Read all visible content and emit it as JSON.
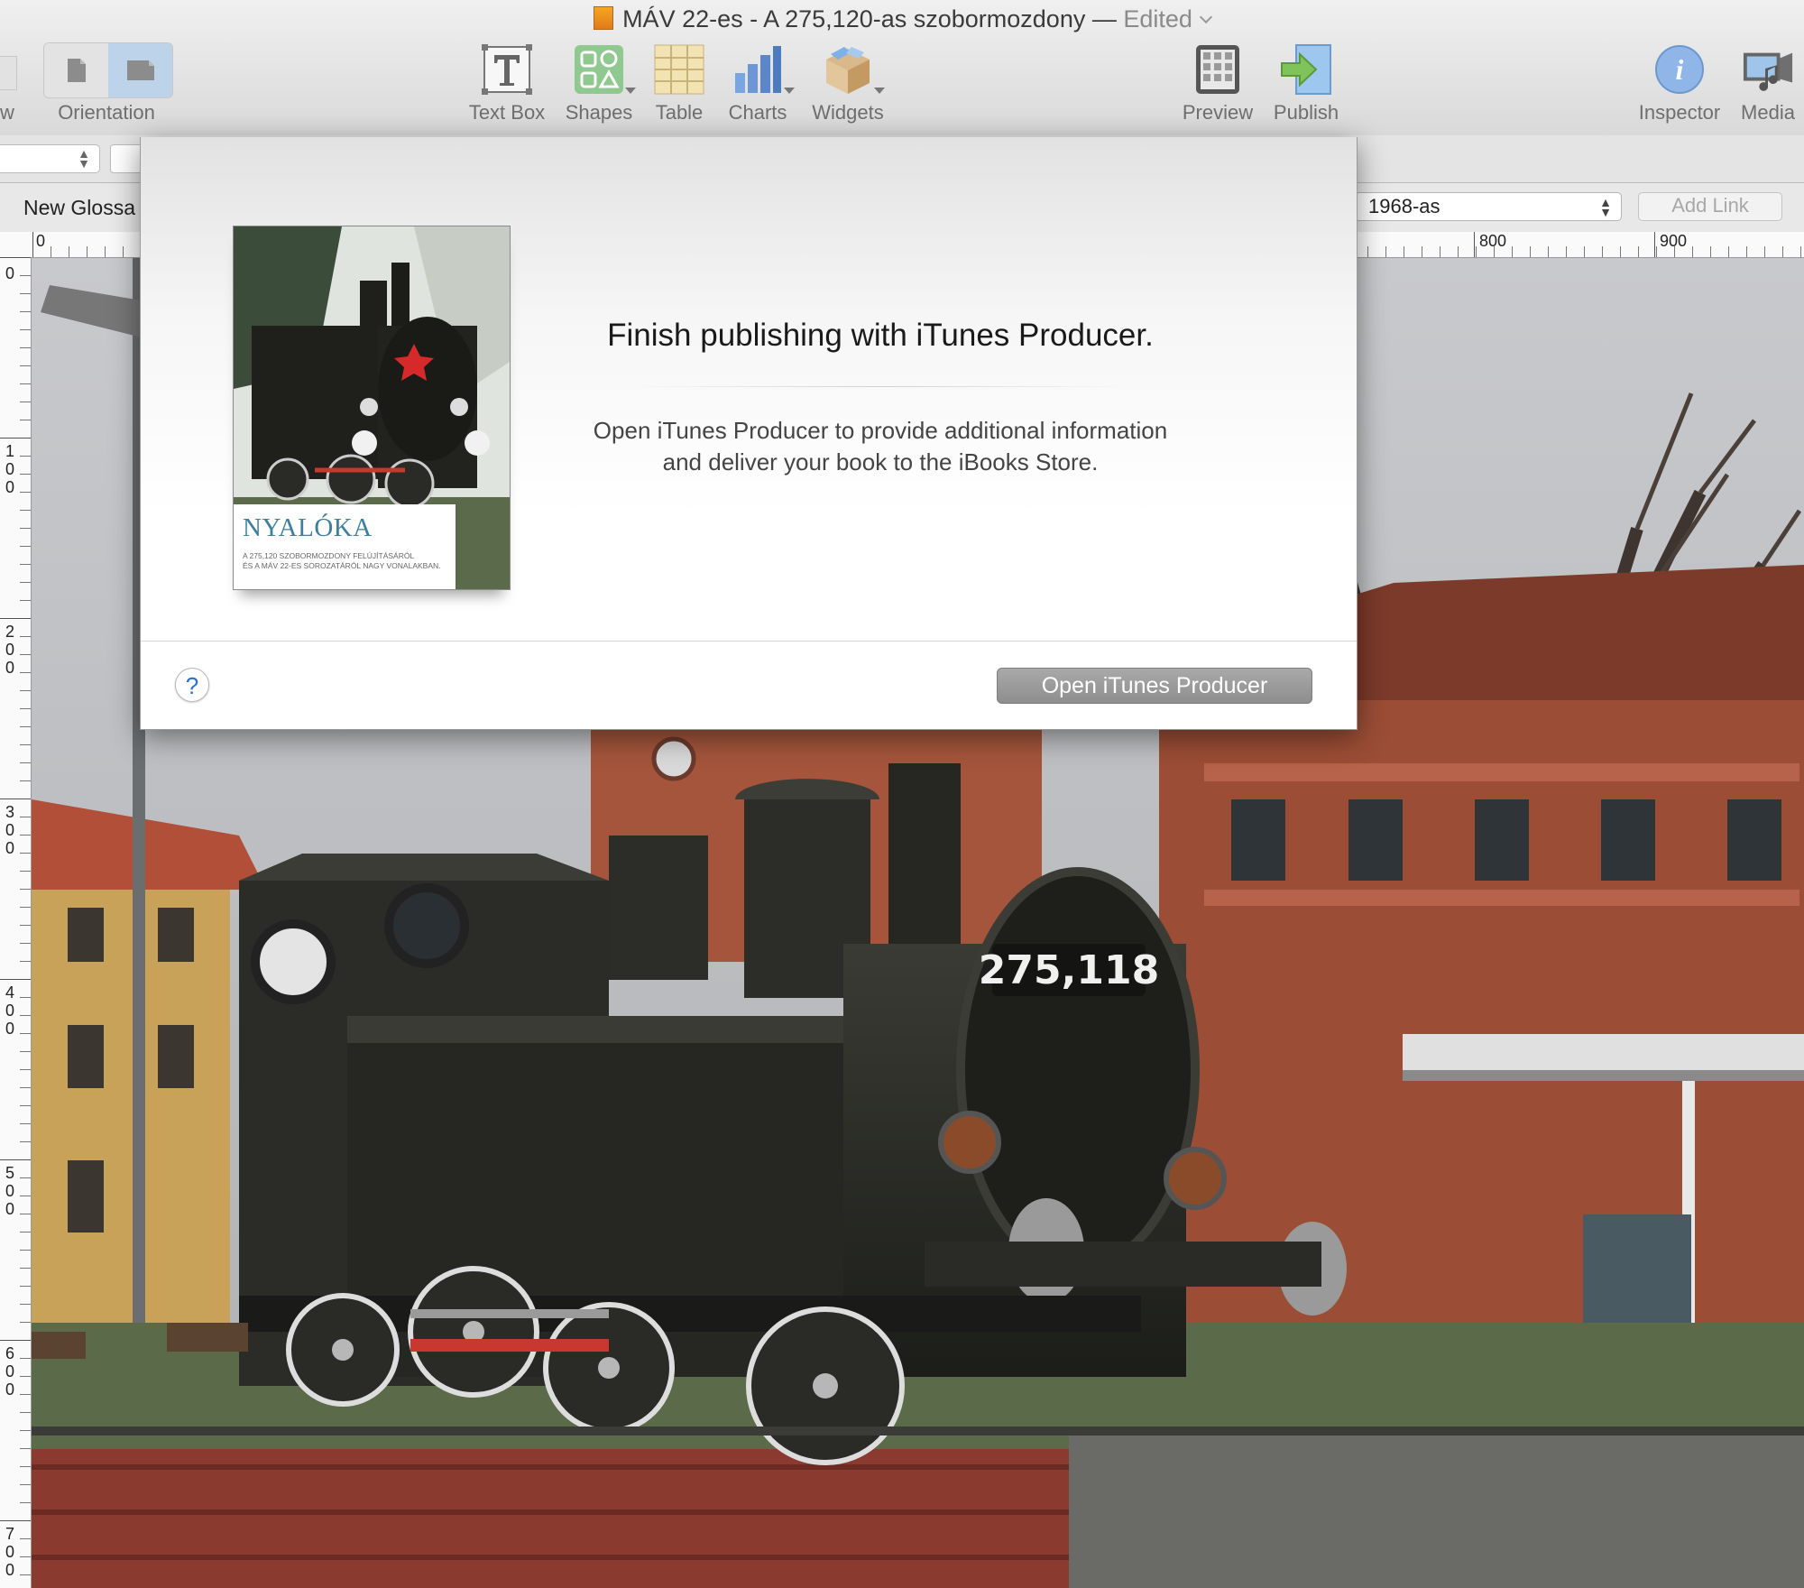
{
  "window": {
    "title": "MÁV 22-es - A 275,120-as szobormozdony",
    "separator": "—",
    "edited": "Edited"
  },
  "toolbar": {
    "left_cut_label": "w",
    "orientation_label": "Orientation",
    "items": [
      {
        "label": "Text Box",
        "icon": "text-box-icon"
      },
      {
        "label": "Shapes",
        "icon": "shapes-icon"
      },
      {
        "label": "Table",
        "icon": "table-icon"
      },
      {
        "label": "Charts",
        "icon": "charts-icon"
      },
      {
        "label": "Widgets",
        "icon": "widgets-icon"
      },
      {
        "label": "Preview",
        "icon": "preview-icon"
      },
      {
        "label": "Publish",
        "icon": "publish-icon"
      },
      {
        "label": "Inspector",
        "icon": "inspector-icon"
      },
      {
        "label": "Media",
        "icon": "media-icon"
      }
    ]
  },
  "link_bar": {
    "glossary_button": "New Glossa",
    "link_select_value": "1968-as",
    "add_link_button": "Add Link"
  },
  "ruler": {
    "horizontal": [
      "0",
      "800",
      "900"
    ],
    "vertical": [
      "0",
      "100",
      "200",
      "300",
      "400",
      "500",
      "600",
      "700"
    ]
  },
  "sheet": {
    "heading": "Finish publishing with iTunes Producer.",
    "body_line1": "Open iTunes Producer to provide additional information",
    "body_line2": "and deliver your book to the iBooks Store.",
    "help_button": "?",
    "open_button": "Open iTunes Producer",
    "cover": {
      "title": "NYALÓKA",
      "subtitle_line1": "A 275,120 SZOBORMOZDONY FELÚJÍTÁSÁRÓL",
      "subtitle_line2": "ÉS A MÁV 22-ES SOROZATÁRÓL NAGY VONALAKBAN."
    }
  },
  "canvas": {
    "locomotive_number": "275,118"
  },
  "colors": {
    "accent_blue": "#3b7fa1",
    "button_gray": "#9a9a9a",
    "help_blue": "#2a6fd0"
  }
}
